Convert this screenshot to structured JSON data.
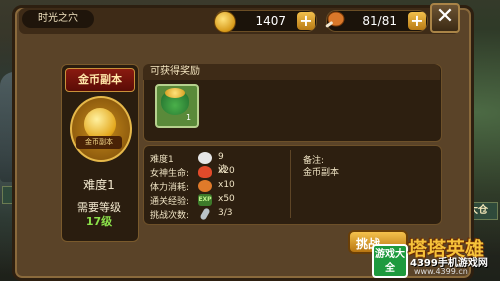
{
  "scene": {
    "left_label": "雕像",
    "right_label": "大仓"
  },
  "header": {
    "title": "时光之穴",
    "gold": "1407",
    "stamina": "81/81",
    "close_label": "✕",
    "plus_label": "+"
  },
  "dungeon": {
    "name": "金币副本",
    "medal_text": "金币副本",
    "difficulty": "难度1",
    "required_label": "需要等级",
    "required_level": "17级"
  },
  "rewards": {
    "title": "可获得奖励",
    "item_count": "1"
  },
  "stats": [
    {
      "label": "难度1",
      "value": "9波",
      "icon": "skull-icon",
      "color": "#e6e6e6"
    },
    {
      "label": "女神生命:",
      "value": "x20",
      "icon": "heart-icon",
      "color": "#e24a2a"
    },
    {
      "label": "体力消耗:",
      "value": "x10",
      "icon": "meat-icon",
      "color": "#e07a2a"
    },
    {
      "label": "通关经验:",
      "value": "x50",
      "icon": "exp-icon",
      "color": "#3d7a2a"
    },
    {
      "label": "挑战次数:",
      "value": "3/3",
      "icon": "sword-icon",
      "color": "#b9c3c8"
    }
  ],
  "note": {
    "label": "备注:",
    "value": "金币副本"
  },
  "challenge_label": "挑战",
  "watermark": {
    "badge": "游戏大全",
    "brand": "塔塔英雄",
    "site": "4399手机游戏网",
    "url": "www.4399.cn"
  }
}
